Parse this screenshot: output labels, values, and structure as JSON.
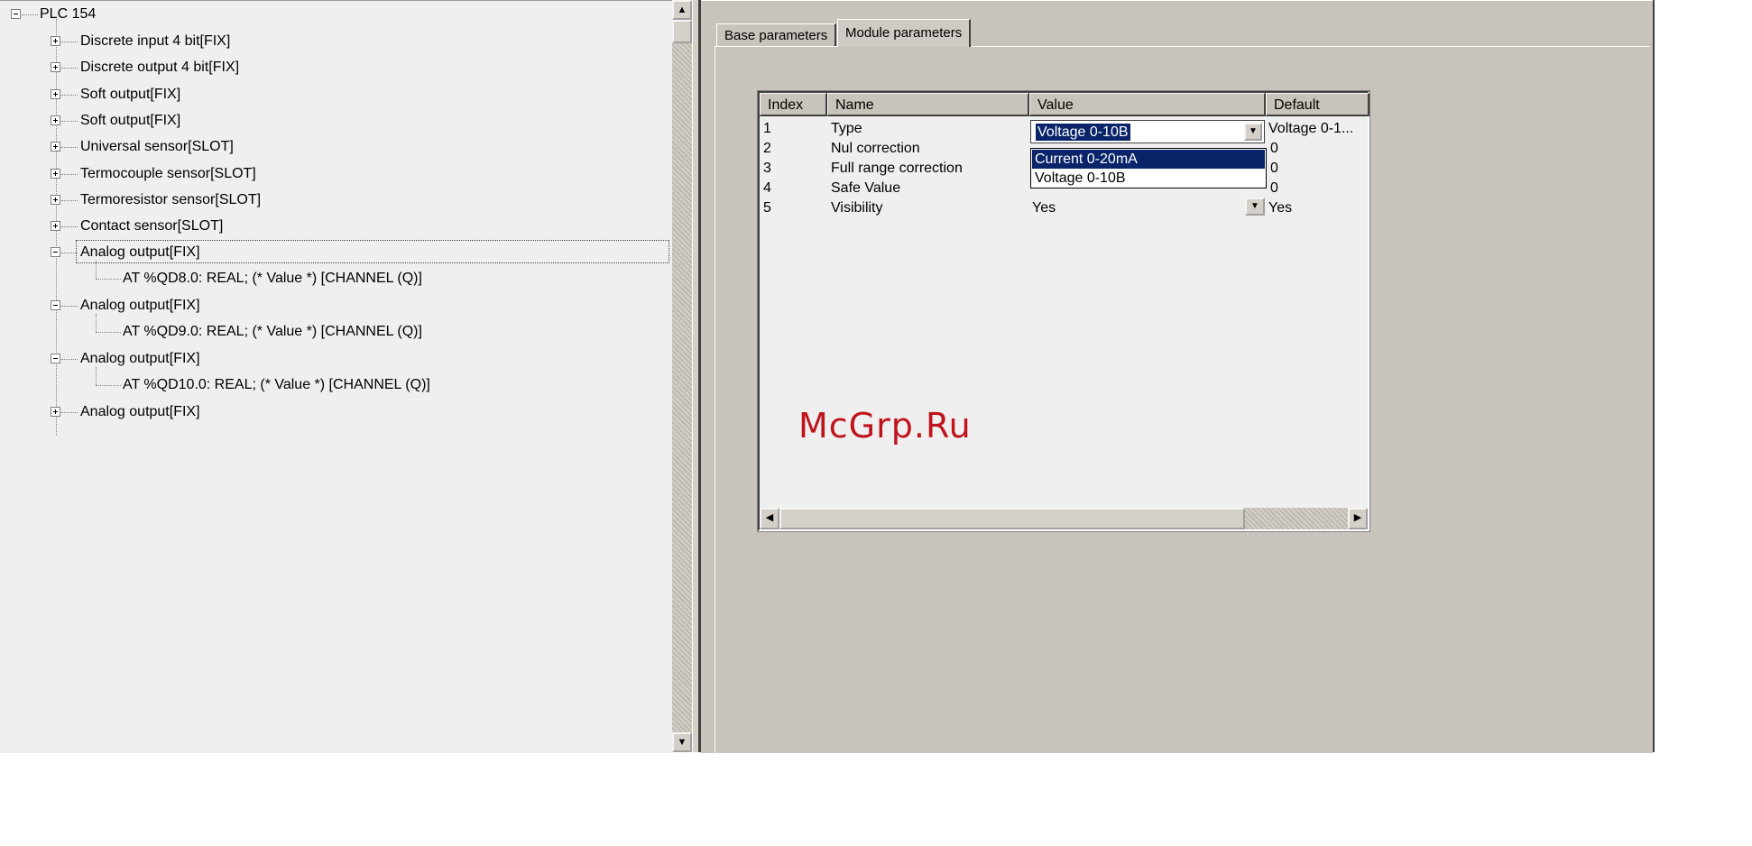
{
  "tree": {
    "root": "PLC 154",
    "items": [
      {
        "label": "Discrete input 4 bit[FIX]",
        "expanded": false
      },
      {
        "label": "Discrete output 4 bit[FIX]",
        "expanded": false
      },
      {
        "label": "Soft output[FIX]",
        "expanded": false
      },
      {
        "label": "Soft output[FIX]",
        "expanded": false
      },
      {
        "label": "Universal sensor[SLOT]",
        "expanded": false
      },
      {
        "label": "Termocouple sensor[SLOT]",
        "expanded": false
      },
      {
        "label": "Termoresistor sensor[SLOT]",
        "expanded": false
      },
      {
        "label": "Contact sensor[SLOT]",
        "expanded": false
      },
      {
        "label": "Analog output[FIX]",
        "expanded": true,
        "selected": true,
        "child": "AT %QD8.0: REAL; (* Value *) [CHANNEL (Q)]"
      },
      {
        "label": "Analog output[FIX]",
        "expanded": true,
        "child": "AT %QD9.0: REAL; (* Value *) [CHANNEL (Q)]"
      },
      {
        "label": "Analog output[FIX]",
        "expanded": true,
        "child": "AT %QD10.0: REAL; (* Value *) [CHANNEL (Q)]"
      },
      {
        "label": "Analog output[FIX]",
        "expanded": false
      }
    ]
  },
  "tabs": {
    "base": "Base parameters",
    "module": "Module parameters"
  },
  "grid": {
    "headers": [
      "Index",
      "Name",
      "Value",
      "Default"
    ],
    "rows": [
      {
        "index": "1",
        "name": "Type",
        "value": "Voltage 0-10B",
        "default": "Voltage 0-1..."
      },
      {
        "index": "2",
        "name": "Nul correction",
        "value": "",
        "default": "0"
      },
      {
        "index": "3",
        "name": "Full range correction",
        "value": "",
        "default": "0"
      },
      {
        "index": "4",
        "name": "Safe Value",
        "value": "",
        "default": "0"
      },
      {
        "index": "5",
        "name": "Visibility",
        "value": "Yes",
        "default": "Yes"
      }
    ],
    "dropdown_options": [
      "Current 0-20mA",
      "Voltage 0-10B"
    ],
    "dropdown_highlighted": "Current 0-20mA"
  },
  "watermark": "McGrp.Ru",
  "colors": {
    "selection": "#0a246a",
    "panel": "#c8c4bc",
    "tree_bg": "#efefef",
    "watermark": "#c0141c"
  }
}
